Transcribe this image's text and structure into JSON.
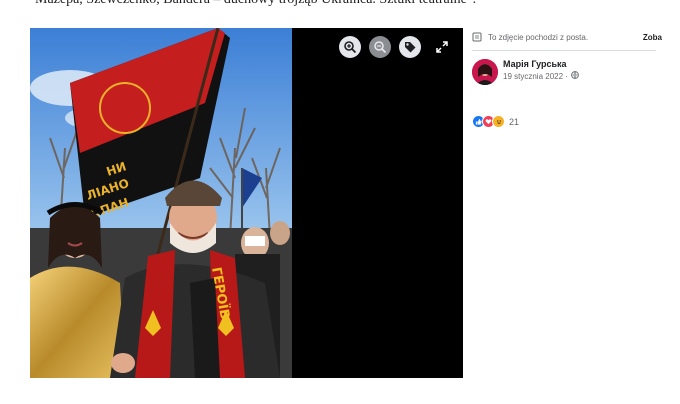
{
  "article": {
    "top_text": "Mazepa, Szewczenko, Bandera – duchowy trójząb Ukraińca. Sztuki teatralne\"."
  },
  "photo": {
    "flag_text_line1": "НИ",
    "flag_text_line2": "ЛІАНО",
    "flag_text_line3": "ОПАН",
    "scarf_text": "ГЕРОЇВ"
  },
  "viewer": {
    "controls": [
      {
        "icon": "zoom-in-icon"
      },
      {
        "icon": "zoom-out-icon"
      },
      {
        "icon": "tag-icon"
      },
      {
        "icon": "fullscreen-icon"
      }
    ]
  },
  "sidebar": {
    "source_text": "To zdjęcie pochodzi z posta.",
    "see_link": "Zoba",
    "author_name": "Марія Гурська",
    "post_date": "19 stycznia 2022 ·",
    "privacy_icon": "globe-icon",
    "reactions": {
      "icons": [
        "like-icon",
        "love-icon",
        "haha-icon"
      ],
      "count": "21"
    }
  },
  "colors": {
    "flag_red": "#c41e1e",
    "flag_black": "#111111",
    "like_blue": "#1877f2",
    "love_red": "#f33e58",
    "haha_yellow": "#f7b125",
    "viewer_bg": "#000000"
  }
}
